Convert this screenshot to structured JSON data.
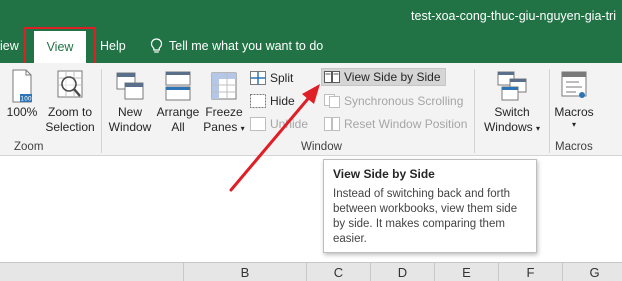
{
  "window": {
    "document_title": "test-xoa-cong-thuc-giu-nguyen-gia-tri"
  },
  "tabs": [
    {
      "label": "iew"
    },
    {
      "label": "View"
    },
    {
      "label": "Help"
    }
  ],
  "tell_me": {
    "label": "Tell me what you want to do",
    "icon": "lightbulb-icon"
  },
  "ribbon": {
    "zoom_group": {
      "label": "Zoom",
      "zoom100_label": "100%",
      "zoom_selection_line1": "Zoom to",
      "zoom_selection_line2": "Selection"
    },
    "window_group": {
      "label": "Window",
      "new_window_line1": "New",
      "new_window_line2": "Window",
      "arrange_all_line1": "Arrange",
      "arrange_all_line2": "All",
      "freeze_panes_line1": "Freeze",
      "freeze_panes_line2": "Panes",
      "split": "Split",
      "hide": "Hide",
      "unhide": "Unhide",
      "view_side_by_side": "View Side by Side",
      "synchronous_scrolling": "Synchronous Scrolling",
      "reset_window_position": "Reset Window Position",
      "switch_windows_line1": "Switch",
      "switch_windows_line2": "Windows"
    },
    "macros_group": {
      "label": "Macros",
      "macros_button": "Macros"
    }
  },
  "tooltip": {
    "title": "View Side by Side",
    "line1": "Instead of switching back and forth",
    "line2": "between workbooks, view them side",
    "line3": "by side. It makes comparing them",
    "line4": "easier."
  },
  "columns": [
    "B",
    "C",
    "D",
    "E",
    "F",
    "G"
  ],
  "colors": {
    "excel_green": "#217346",
    "highlight_red": "#e01e26",
    "ribbon_bg": "#f3f3f3"
  }
}
